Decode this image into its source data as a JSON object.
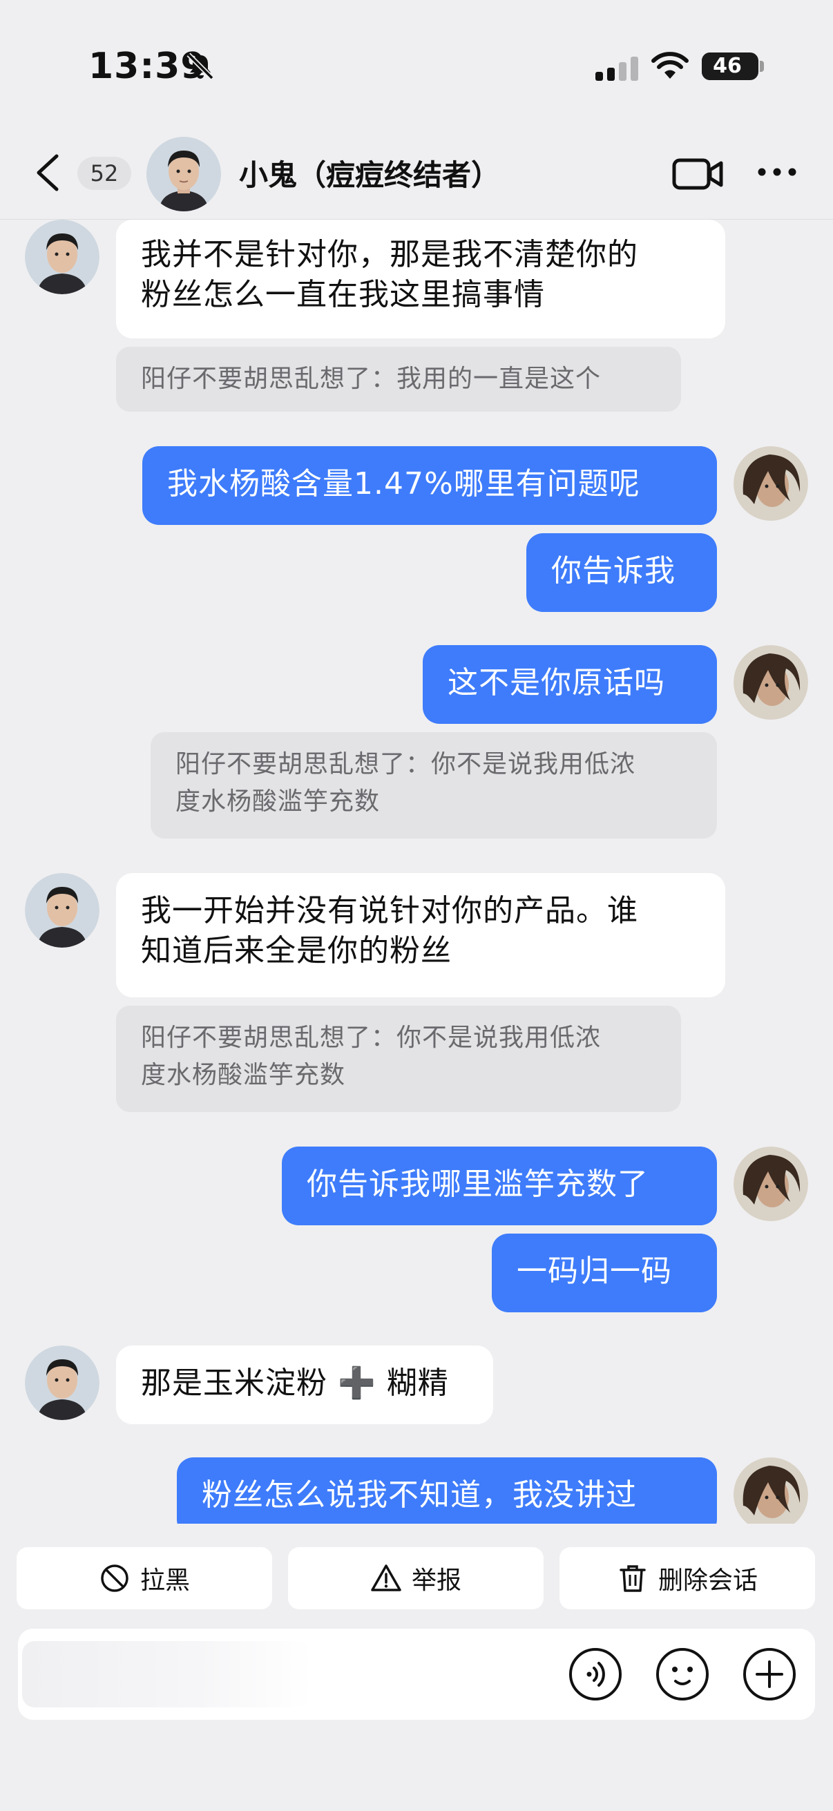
{
  "status_bar": {
    "time": "13:39",
    "battery": "46",
    "battery_level": 0.46
  },
  "header": {
    "unread_count": "52",
    "contact_name": "小鬼（痘痘终结者）"
  },
  "messages": [
    {
      "from": "them",
      "lines": [
        "我并不是针对你，那是我不清楚你的",
        "粉丝怎么一直在我这里搞事情"
      ]
    },
    {
      "quote": true,
      "lines": [
        "阳仔不要胡思乱想了：我用的一直是这个"
      ]
    },
    {
      "from": "me",
      "lines": [
        "我水杨酸含量1.47%哪里有问题呢"
      ]
    },
    {
      "from": "me",
      "lines": [
        "你告诉我"
      ]
    },
    {
      "from": "me",
      "lines": [
        "这不是你原话吗"
      ]
    },
    {
      "quote": true,
      "lines": [
        "阳仔不要胡思乱想了：你不是说我用低浓",
        "度水杨酸滥竽充数"
      ]
    },
    {
      "from": "them",
      "lines": [
        "我一开始并没有说针对你的产品。谁",
        "知道后来全是你的粉丝"
      ]
    },
    {
      "quote": true,
      "lines": [
        "阳仔不要胡思乱想了：你不是说我用低浓",
        "度水杨酸滥竽充数"
      ]
    },
    {
      "from": "me",
      "lines": [
        "你告诉我哪里滥竽充数了"
      ]
    },
    {
      "from": "me",
      "lines": [
        "一码归一码"
      ]
    },
    {
      "from": "them",
      "lines": [
        "那是玉米淀粉 ➕ 糊精"
      ]
    },
    {
      "from": "me",
      "lines": [
        "粉丝怎么说我不知道，我没讲过"
      ]
    }
  ],
  "actions": {
    "block": "拉黑",
    "report": "举报",
    "delete": "删除会话"
  },
  "input": {
    "value": ""
  },
  "colors": {
    "outgoing_bubble": "#3e7cfb",
    "incoming_bubble": "#ffffff",
    "background": "#efeff1"
  }
}
